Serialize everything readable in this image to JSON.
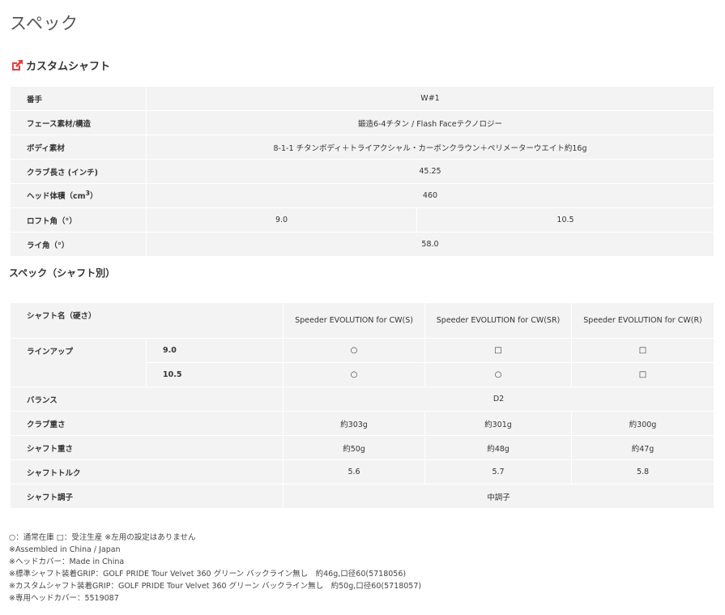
{
  "page": {
    "title": "スペック",
    "section_title": "カスタムシャフト",
    "sub_title": "スペック（シャフト別）",
    "accent_color": "#e43f3f",
    "section_icon": "external-link-icon"
  },
  "table1": {
    "rows": [
      {
        "label": "番手",
        "value": "W#1"
      },
      {
        "label": "フェース素材/構造",
        "value": "鍛造6-4チタン / Flash Faceテクノロジー"
      },
      {
        "label": "ボディ素材",
        "value": "8-1-1 チタンボディ＋トライアクシャル・カーボンクラウン＋ペリメーターウエイト約16g"
      },
      {
        "label": "クラブ長さ (インチ)",
        "value": "45.25"
      },
      {
        "label": "ヘッド体積（cm",
        "label_sup": "3",
        "label_suffix": "）",
        "value": "460"
      },
      {
        "label": "ロフト角（°）",
        "values": [
          "9.0",
          "10.5"
        ]
      },
      {
        "label": "ライ角（°）",
        "value": "58.0"
      }
    ]
  },
  "table2": {
    "header_label": "シャフト名（硬さ）",
    "columns": [
      "Speeder EVOLUTION for CW(S)",
      "Speeder EVOLUTION for CW(SR)",
      "Speeder EVOLUTION for CW(R)"
    ],
    "lineup_label": "ラインアップ",
    "lineup": [
      {
        "loft": "9.0",
        "marks": [
          "○",
          "□",
          "□"
        ]
      },
      {
        "loft": "10.5",
        "marks": [
          "○",
          "○",
          "□"
        ]
      }
    ],
    "balance": {
      "label": "バランス",
      "value": "D2"
    },
    "club_weight": {
      "label": "クラブ重さ",
      "values": [
        "約303g",
        "約301g",
        "約300g"
      ]
    },
    "shaft_weight": {
      "label": "シャフト重さ",
      "values": [
        "約50g",
        "約48g",
        "約47g"
      ]
    },
    "shaft_torque": {
      "label": "シャフトトルク",
      "values": [
        "5.6",
        "5.7",
        "5.8"
      ]
    },
    "shaft_kick": {
      "label": "シャフト調子",
      "value": "中調子"
    }
  },
  "notes": [
    "○：通常在庫 □：受注生産 ※左用の設定はありません",
    "※Assembled in China / Japan",
    "※ヘッドカバー：Made in China",
    "※標準シャフト装着GRIP：GOLF PRIDE Tour Velvet 360 グリーン バックライン無し　約46g,口径60(5718056)",
    "※カスタムシャフト装着GRIP：GOLF PRIDE Tour Velvet 360 グリーン バックライン無し　約50g,口径60(5718057)",
    "※専用ヘッドカバー：5519087"
  ]
}
